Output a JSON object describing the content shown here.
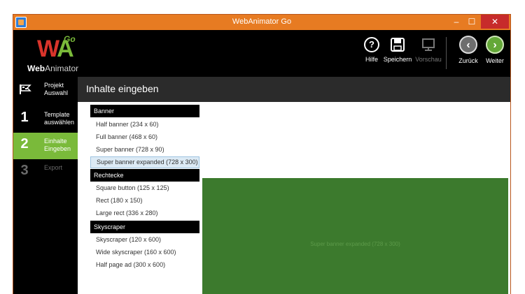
{
  "window": {
    "title": "WebAnimator Go",
    "minimize": "–",
    "maximize": "☐",
    "close": "✕"
  },
  "logo": {
    "mark_w": "W",
    "mark_a": "A",
    "go": "Go",
    "text_web": "Web",
    "text_animator": "Animator"
  },
  "toolbar": {
    "help": {
      "label": "Hilfe",
      "icon": "help-icon"
    },
    "save": {
      "label": "Speichern",
      "icon": "save-icon"
    },
    "preview": {
      "label": "Vorschau",
      "icon": "monitor-icon"
    },
    "back": {
      "label": "Zurück",
      "icon": "back-arrow-icon",
      "glyph": "‹"
    },
    "next": {
      "label": "Weiter",
      "icon": "next-arrow-icon",
      "glyph": "›"
    }
  },
  "steps": [
    {
      "number": "",
      "label": "Projekt Auswahl",
      "icon": "flag-icon"
    },
    {
      "number": "1",
      "label": "Template auswählen"
    },
    {
      "number": "2",
      "label": "Einhalte Eingeben",
      "active": true
    },
    {
      "number": "3",
      "label": "Export",
      "disabled": true
    }
  ],
  "content": {
    "title": "Inhalte eingeben"
  },
  "groups": [
    {
      "name": "Banner",
      "items": [
        "Half banner (234 x 60)",
        "Full banner (468 x 60)",
        "Super banner (728 x 90)",
        "Super banner expanded (728 x 300)"
      ]
    },
    {
      "name": "Rechtecke",
      "items": [
        "Square button (125 x 125)",
        "Rect (180 x 150)",
        "Large rect (336 x 280)"
      ]
    },
    {
      "name": "Skyscraper",
      "items": [
        "Skyscraper (120 x 600)",
        "Wide skyscraper (160 x 600)",
        "Half page ad (300 x 600)"
      ]
    }
  ],
  "selected_item": "Super banner expanded (728 x 300)",
  "preview": {
    "label": "Super banner expanded (728 x 300)"
  },
  "colors": {
    "accent_green": "#7aba3a",
    "title_orange": "#e77b22",
    "preview_green": "#3c7a2d",
    "close_red": "#c72b2b"
  }
}
